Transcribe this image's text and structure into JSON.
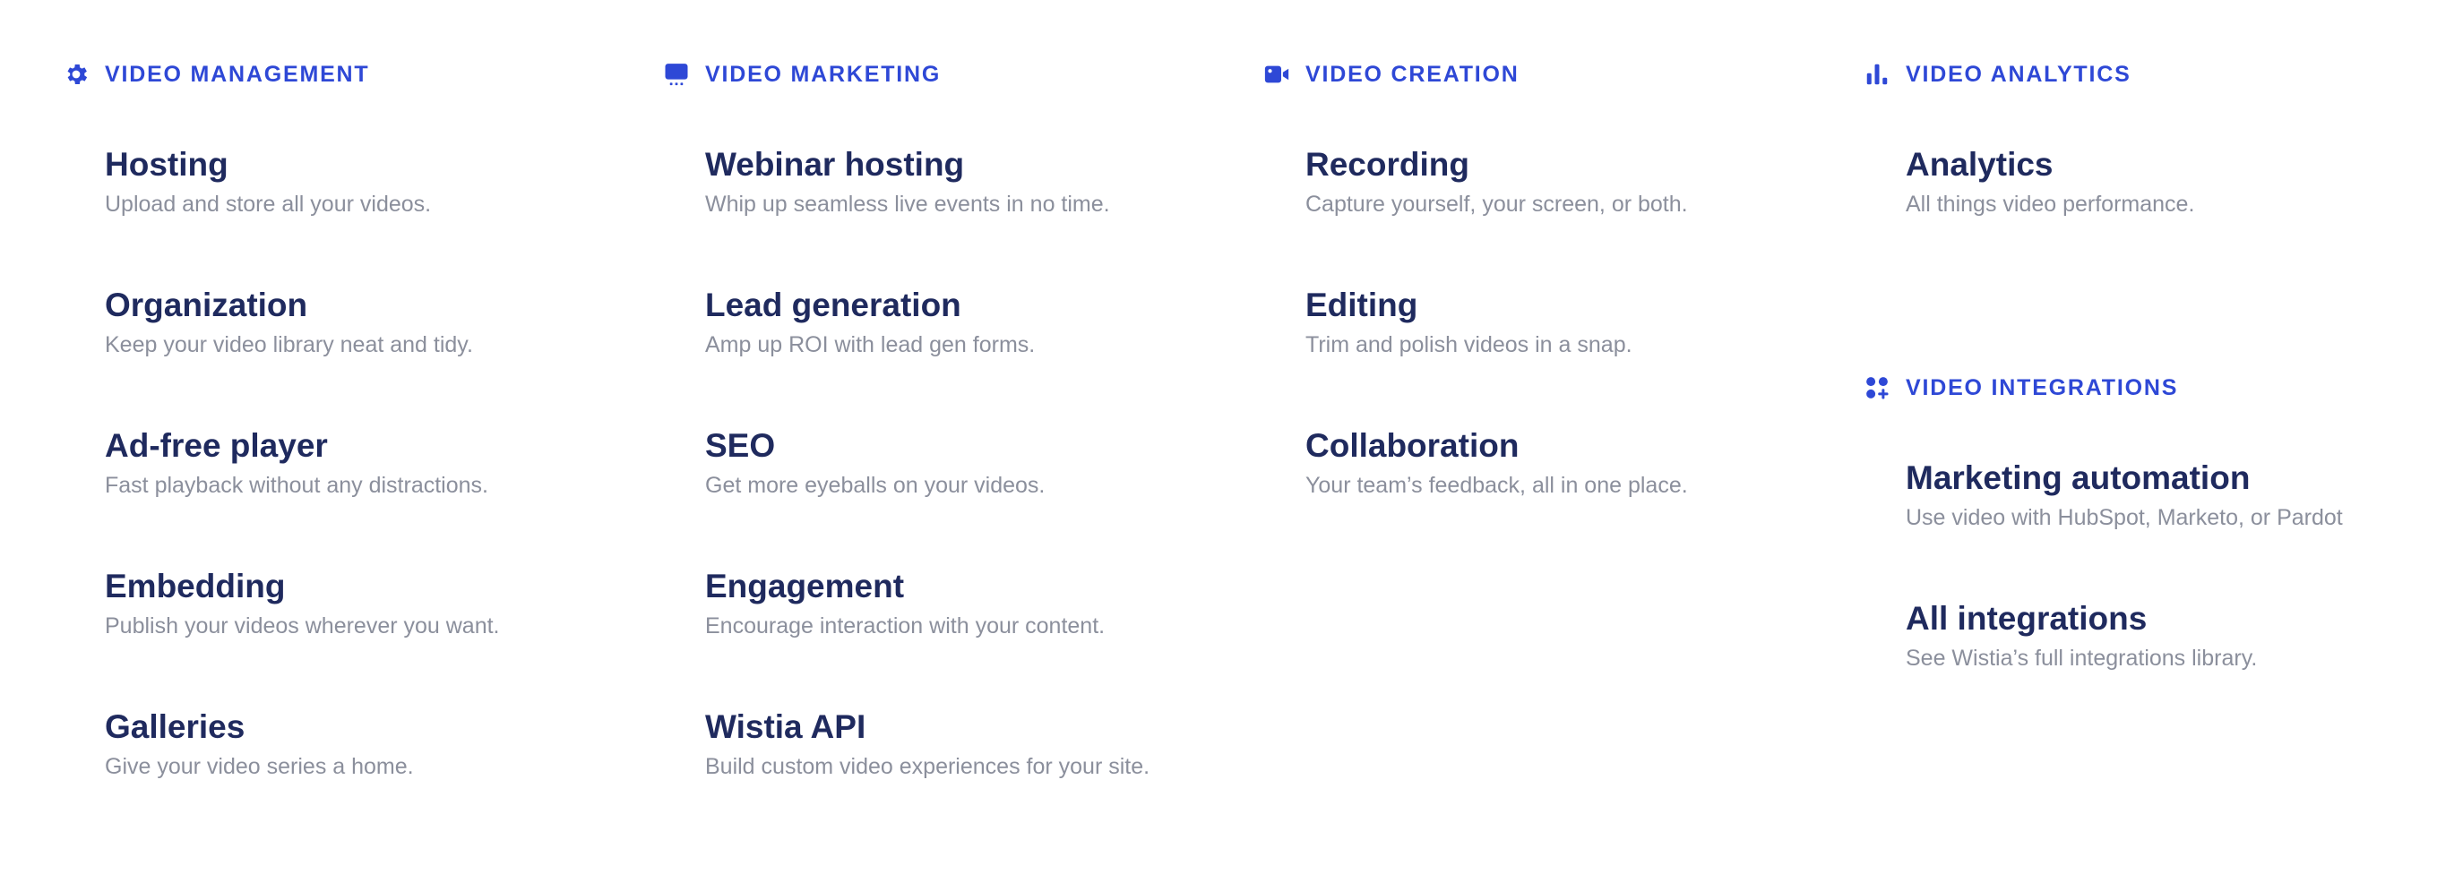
{
  "colors": {
    "accent": "#2e48d6",
    "item_title": "#1f2a5e",
    "item_description": "#8b8f9c",
    "background": "#ffffff"
  },
  "sections": {
    "management": {
      "icon": "gear-icon",
      "title": "VIDEO MANAGEMENT",
      "items": [
        {
          "title": "Hosting",
          "description": "Upload and store all your videos."
        },
        {
          "title": "Organization",
          "description": "Keep your video library neat and tidy."
        },
        {
          "title": "Ad-free player",
          "description": "Fast playback without any distractions."
        },
        {
          "title": "Embedding",
          "description": "Publish your videos wherever you want."
        },
        {
          "title": "Galleries",
          "description": "Give your video series a home."
        }
      ]
    },
    "marketing": {
      "icon": "presentation-screen-icon",
      "title": "VIDEO MARKETING",
      "items": [
        {
          "title": "Webinar hosting",
          "description": "Whip up seamless live events in no time."
        },
        {
          "title": "Lead generation",
          "description": "Amp up ROI with lead gen forms."
        },
        {
          "title": "SEO",
          "description": "Get more eyeballs on your videos."
        },
        {
          "title": "Engagement",
          "description": "Encourage interaction with your content."
        },
        {
          "title": "Wistia API",
          "description": "Build custom video experiences for your site."
        }
      ]
    },
    "creation": {
      "icon": "video-camera-icon",
      "title": "VIDEO CREATION",
      "items": [
        {
          "title": "Recording",
          "description": "Capture yourself, your screen, or both."
        },
        {
          "title": "Editing",
          "description": "Trim and polish videos in a snap."
        },
        {
          "title": "Collaboration",
          "description": "Your team’s feedback, all in one place."
        }
      ]
    },
    "analytics": {
      "icon": "bar-chart-icon",
      "title": "VIDEO ANALYTICS",
      "items": [
        {
          "title": "Analytics",
          "description": "All things video performance."
        }
      ]
    },
    "integrations": {
      "icon": "apps-plus-icon",
      "title": "VIDEO INTEGRATIONS",
      "items": [
        {
          "title": "Marketing automation",
          "description": "Use video with HubSpot, Marketo, or Pardot"
        },
        {
          "title": "All integrations",
          "description": "See Wistia’s full integrations library."
        }
      ]
    }
  }
}
